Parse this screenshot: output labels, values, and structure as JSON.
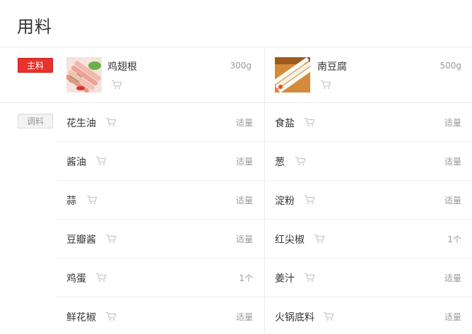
{
  "section_title": "用料",
  "main": {
    "badge": "主料",
    "items": [
      {
        "name": "鸡翅根",
        "qty": "300g",
        "image": "chicken-wing-photo"
      },
      {
        "name": "南豆腐",
        "qty": "500g",
        "image": "tofu-photo"
      }
    ]
  },
  "seasoning": {
    "badge": "调料",
    "rows": [
      {
        "left": {
          "name": "花生油",
          "qty": "适量"
        },
        "right": {
          "name": "食盐",
          "qty": "适量"
        }
      },
      {
        "left": {
          "name": "酱油",
          "qty": "适量"
        },
        "right": {
          "name": "葱",
          "qty": "适量"
        }
      },
      {
        "left": {
          "name": "蒜",
          "qty": "适量"
        },
        "right": {
          "name": "淀粉",
          "qty": "适量"
        }
      },
      {
        "left": {
          "name": "豆瓣酱",
          "qty": "适量"
        },
        "right": {
          "name": "红尖椒",
          "qty": "1个"
        }
      },
      {
        "left": {
          "name": "鸡蛋",
          "qty": "1个"
        },
        "right": {
          "name": "姜汁",
          "qty": "适量"
        }
      },
      {
        "left": {
          "name": "鲜花椒",
          "qty": "适量"
        },
        "right": {
          "name": "火锅底料",
          "qty": "适量"
        }
      }
    ]
  },
  "colors": {
    "main_badge": "#e8322d",
    "cart_icon": "#c8c8c8",
    "divider": "#eaeaea"
  }
}
